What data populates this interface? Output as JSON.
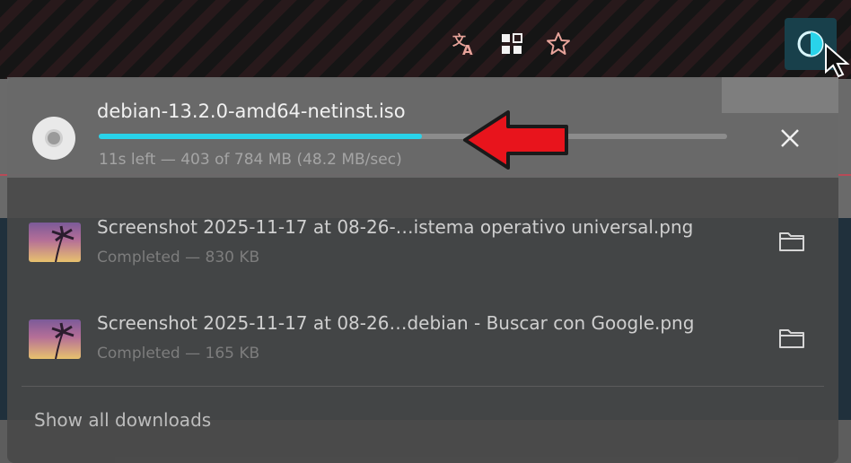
{
  "toolbar": {
    "icons": [
      "translate-icon",
      "extensions-grid-icon",
      "bookmark-star-icon",
      "downloads-progress-icon"
    ],
    "accent": "#29d3ea"
  },
  "downloads": {
    "active": {
      "filename": "debian-13.2.0-amd64-netinst.iso",
      "status": "11s left — 403 of 784 MB (48.2 MB/sec)",
      "progress_fraction": 0.514,
      "icon": "disc-icon"
    },
    "completed": [
      {
        "filename": "Screenshot 2025-11-17 at 08-26-…istema operativo universal.png",
        "status": "Completed — 830 KB"
      },
      {
        "filename": "Screenshot 2025-11-17 at 08-26…debian - Buscar con Google.png",
        "status": "Completed — 165 KB"
      }
    ],
    "show_all_label": "Show all downloads"
  },
  "annotation": {
    "arrow_color": "#e8141c"
  }
}
